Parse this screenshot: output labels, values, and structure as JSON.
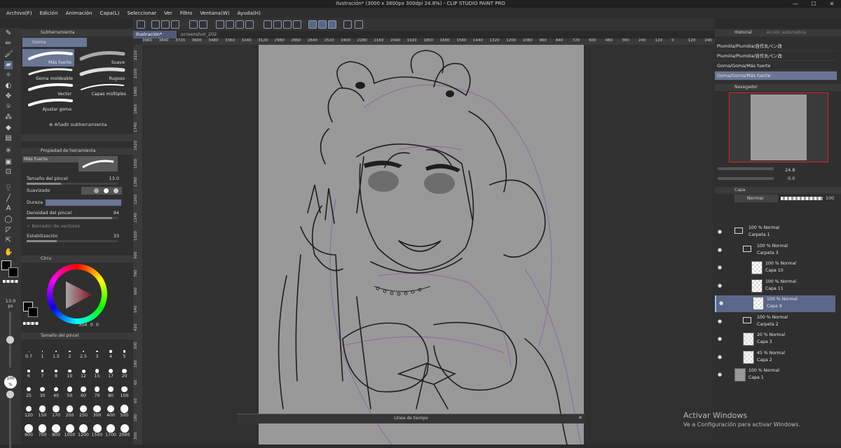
{
  "window": {
    "title": "Ilustración* (3000 x 3800px 300dpi 24.8%)  - CLIP STUDIO PAINT PRO",
    "min_label": "—",
    "max_label": "☐",
    "close_label": "✕"
  },
  "menu": [
    "Archivo(F)",
    "Edición",
    "Animación",
    "Capa(L)",
    "Seleccionar",
    "Ver",
    "Filtro",
    "Ventana(W)",
    "Ayuda(H)"
  ],
  "subtool": {
    "header": "Subherramienta",
    "group": "Goma",
    "brushes": [
      {
        "label": "Más fuerte",
        "selected": true
      },
      {
        "label": "Suave",
        "selected": false
      },
      {
        "label": "Goma moldeable",
        "selected": false
      },
      {
        "label": "Rugoso",
        "selected": false
      },
      {
        "label": "Vector",
        "selected": false
      },
      {
        "label": "Capas múltiples",
        "selected": false
      },
      {
        "label": "Ajustar goma",
        "selected": false
      }
    ],
    "add_label": "Añadir subherramienta"
  },
  "tool_property": {
    "header": "Propiedad de herramienta",
    "preset": "Más fuerte",
    "brush_size_label": "Tamaño del pincel",
    "brush_size_value": "13.0",
    "smoothing_label": "Suavizado",
    "hardness_label": "Dureza",
    "density_label": "Densidad del pincel",
    "density_value": "94",
    "vector_eraser_label": "Borrador de vectores",
    "stabilization_label": "Estabilización",
    "stabilization_value": "33"
  },
  "color": {
    "header": "Círcu",
    "main": "#0a0a0a",
    "sub": "#ffffff",
    "hue": "#d3223f",
    "values": [
      "354",
      "0",
      "0"
    ]
  },
  "tool_size_indicator": {
    "value": "13.0",
    "unit": "px",
    "opacity": "100",
    "opacity_unit": "%"
  },
  "brush_size_panel": {
    "header": "Tamaño del pincel",
    "sizes": [
      "0.7",
      "1",
      "1.5",
      "2",
      "2.5",
      "3",
      "4",
      "5",
      "6",
      "7",
      "8",
      "10",
      "12",
      "15",
      "17",
      "20",
      "25",
      "30",
      "40",
      "50",
      "60",
      "70",
      "80",
      "100",
      "120",
      "150",
      "170",
      "200",
      "250",
      "300",
      "400",
      "500",
      "600",
      "700",
      "800",
      "1000",
      "1200",
      "1500",
      "1700",
      "2000"
    ]
  },
  "tabs": [
    {
      "label": "Ilustración*",
      "active": true
    },
    {
      "label": "screenshot_202",
      "active": false
    }
  ],
  "ruler_top": [
    "3960",
    "3840",
    "3720",
    "3600",
    "3480",
    "3360",
    "3240",
    "3120",
    "2980",
    "2860",
    "2640",
    "2520",
    "2400",
    "2280",
    "2160",
    "2040",
    "1920",
    "1800",
    "1680",
    "1560",
    "1440",
    "1320",
    "1200",
    "1080",
    "960",
    "840",
    "720",
    "600",
    "480",
    "360",
    "240",
    "120",
    "0",
    "120",
    "240",
    "360"
  ],
  "ruler_left": [
    "2220",
    "2100",
    "1980",
    "1860",
    "1740",
    "1620",
    "1500",
    "1380",
    "1260",
    "1140",
    "1020",
    "900",
    "780",
    "660",
    "540",
    "420",
    "300",
    "180",
    "60",
    "60",
    "180",
    "300"
  ],
  "timeline_title": "Línea de tiempo",
  "history": {
    "tab1": "Historial",
    "tab2": "Acción automática",
    "items": [
      {
        "label": "Plumilla/Plumilla/自作丸ペン改",
        "selected": false
      },
      {
        "label": "Plumilla/Plumilla/自作丸ペン改",
        "selected": false
      },
      {
        "label": "Goma/Goma/Más fuerte",
        "selected": false
      },
      {
        "label": "Goma/Goma/Más fuerte",
        "selected": true
      }
    ]
  },
  "navigator": {
    "header": "Navegador",
    "zoom": "24.8",
    "rotation": "0.0"
  },
  "layers": {
    "header": "Capa",
    "blend_mode": "Normal",
    "opacity": "100",
    "items": [
      {
        "mode": "100 % Normal",
        "name": "Carpeta 1",
        "folder": true,
        "selected": false,
        "indent": 0
      },
      {
        "mode": "100 % Normal",
        "name": "Carpeta 3",
        "folder": true,
        "selected": false,
        "indent": 1
      },
      {
        "mode": "100 % Normal",
        "name": "Capa 10",
        "folder": false,
        "selected": false,
        "indent": 2
      },
      {
        "mode": "100 % Normal",
        "name": "Capa 11",
        "folder": false,
        "selected": false,
        "indent": 2
      },
      {
        "mode": "100 % Normal",
        "name": "Capa 9",
        "folder": false,
        "selected": true,
        "indent": 2
      },
      {
        "mode": "100 % Normal",
        "name": "Carpeta 2",
        "folder": true,
        "selected": false,
        "indent": 1
      },
      {
        "mode": "20 % Normal",
        "name": "Capa 3",
        "folder": false,
        "selected": false,
        "indent": 1
      },
      {
        "mode": "45 % Normal",
        "name": "Capa 2",
        "folder": false,
        "selected": false,
        "indent": 1
      },
      {
        "mode": "100 % Normal",
        "name": "Capa 1",
        "folder": false,
        "selected": false,
        "indent": 0
      }
    ]
  },
  "watermark": {
    "title": "Activar Windows",
    "subtitle": "Ve a Configuración para activar Windows."
  }
}
